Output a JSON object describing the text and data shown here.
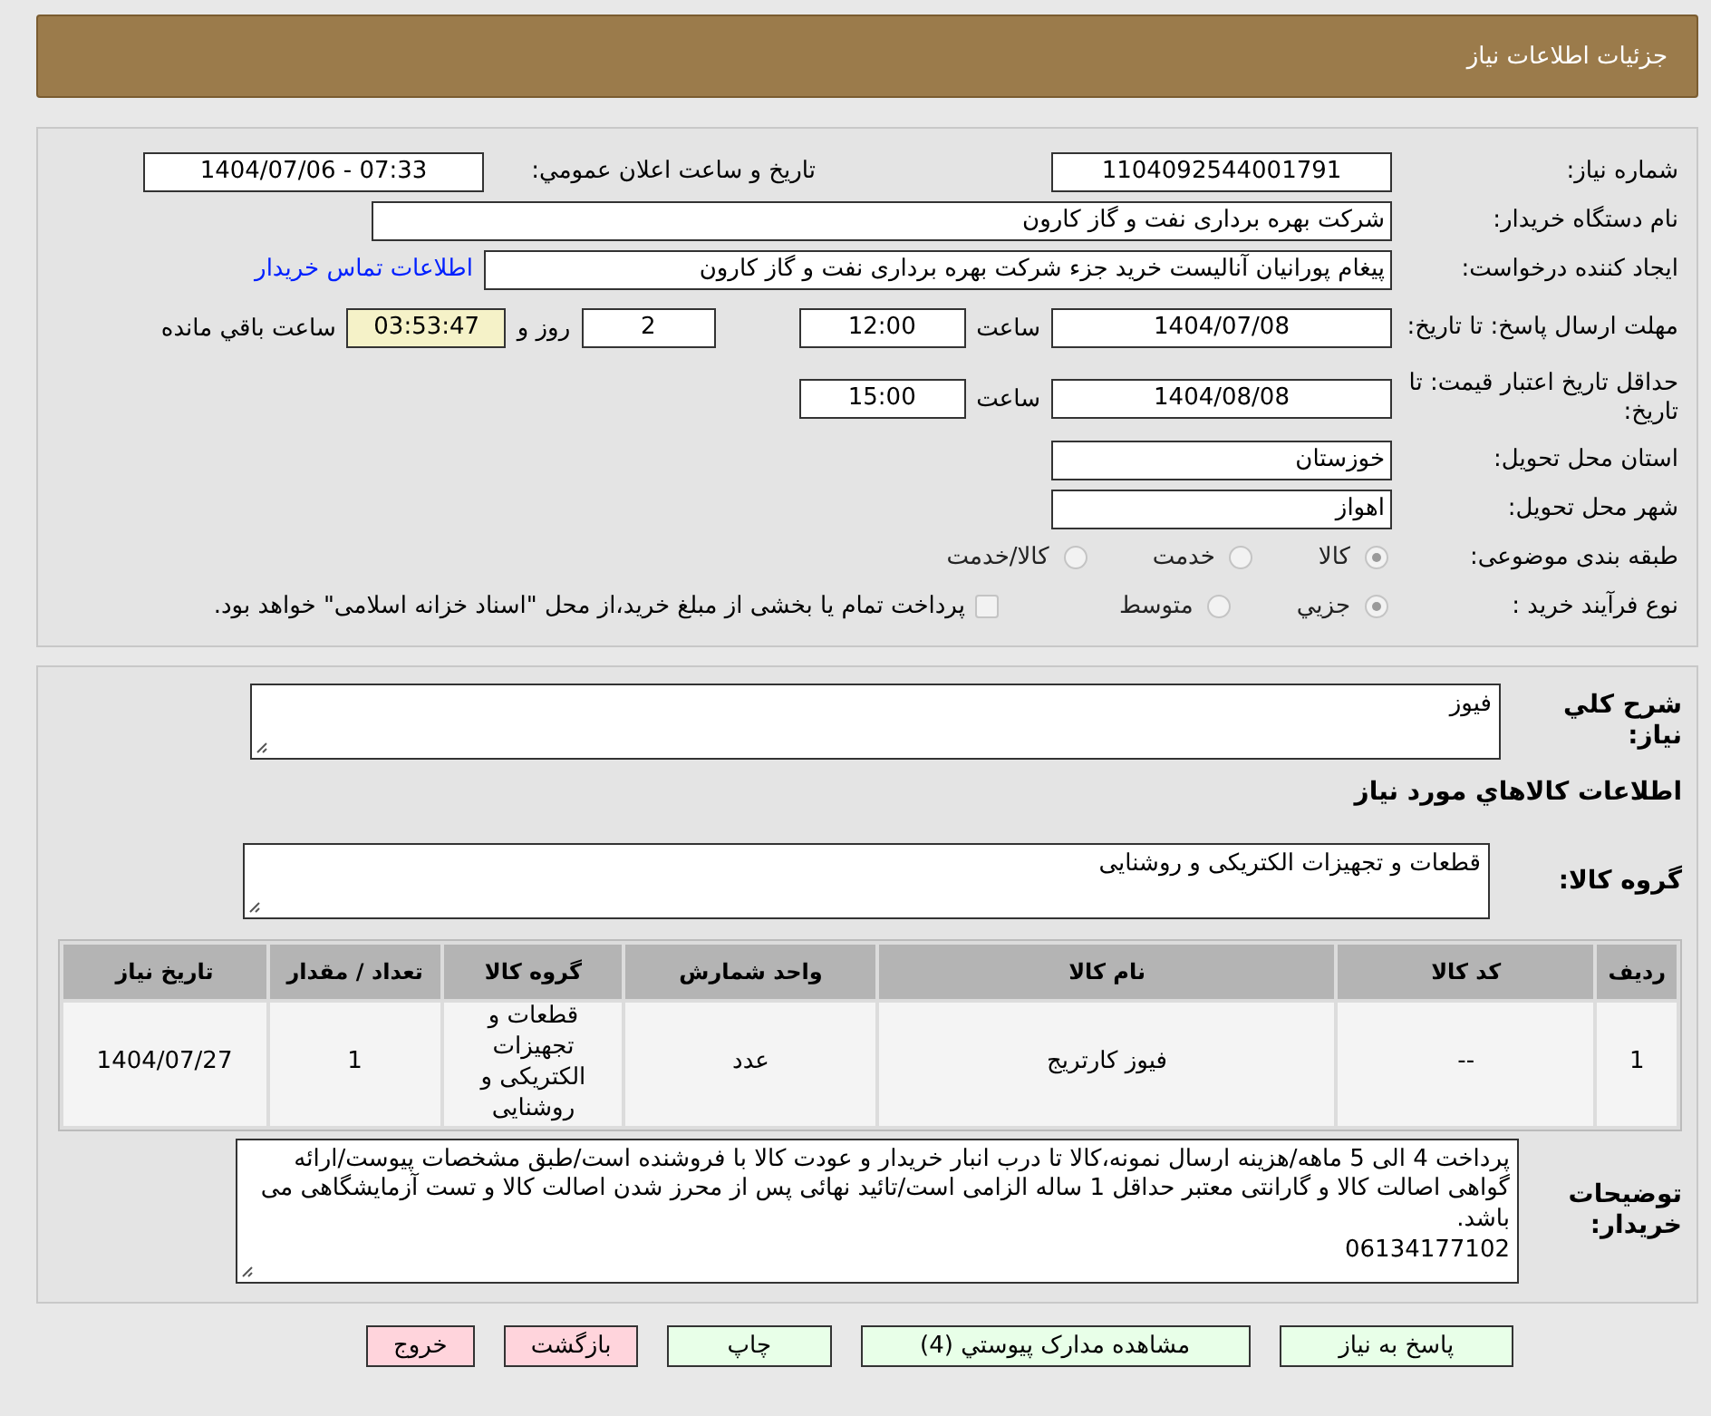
{
  "header": {
    "title": "جزئیات اطلاعات نیاز"
  },
  "details": {
    "need_number": {
      "label": "شماره نیاز:",
      "value": "1104092544001791"
    },
    "announce": {
      "label": "تاریخ و ساعت اعلان عمومي:",
      "value": "1404/07/06 - 07:33"
    },
    "buyer": {
      "label": "نام دستگاه خریدار:",
      "value": "شرکت بهره برداری نفت و گاز کارون"
    },
    "creator": {
      "label": "ایجاد کننده درخواست:",
      "value": "پیغام پورانیان آنالیست خرید جزء شرکت بهره برداری نفت و گاز کارون",
      "link": "اطلاعات تماس خریدار"
    },
    "deadline": {
      "label": "مهلت ارسال پاسخ: تا تاریخ:",
      "date": "1404/07/08",
      "time_label": "ساعت",
      "time": "12:00",
      "days": "2",
      "days_label": "روز و",
      "remaining": "03:53:47",
      "remaining_label": "ساعت باقي مانده"
    },
    "validity": {
      "label": "حداقل تاریخ اعتبار قیمت: تا تاریخ:",
      "date": "1404/08/08",
      "time_label": "ساعت",
      "time": "15:00"
    },
    "province": {
      "label": "استان محل تحویل:",
      "value": "خوزستان"
    },
    "city": {
      "label": "شهر محل تحویل:",
      "value": "اهواز"
    },
    "category": {
      "label": "طبقه بندی موضوعی:",
      "options": [
        {
          "label": "کالا",
          "selected": true
        },
        {
          "label": "خدمت",
          "selected": false
        },
        {
          "label": "کالا/خدمت",
          "selected": false
        }
      ]
    },
    "process": {
      "label": "نوع فرآیند خرید :",
      "options": [
        {
          "label": "جزيي",
          "selected": true
        },
        {
          "label": "متوسط",
          "selected": false
        }
      ],
      "treasury": {
        "label": "پرداخت تمام یا بخشی از مبلغ خرید،از محل \"اسناد خزانه اسلامی\" خواهد بود.",
        "checked": false
      }
    }
  },
  "summary": {
    "label": "شرح کلي نیاز:",
    "value": "فیوز"
  },
  "goods_heading": "اطلاعات کالاهاي مورد نیاز",
  "goods_group": {
    "label": "گروه کالا:",
    "value": "قطعات و تجهیزات الکتریکی و روشنایی"
  },
  "table": {
    "columns": [
      "ردیف",
      "کد کالا",
      "نام کالا",
      "واحد شمارش",
      "گروه کالا",
      "تعداد / مقدار",
      "تاریخ نیاز"
    ],
    "rows": [
      [
        "1",
        "--",
        "فیوز کارتریج",
        "عدد",
        "قطعات و تجهیزات الکتریکی و روشنایی",
        "1",
        "1404/07/27"
      ]
    ]
  },
  "notes": {
    "label": "توضیحات خریدار:",
    "value": "پرداخت 4 الی 5 ماهه/هزینه ارسال نمونه،کالا تا درب انبار خریدار و عودت کالا با فروشنده است/طبق مشخصات پیوست/ارائه گواهی اصالت کالا و گارانتی معتبر حداقل 1 ساله الزامی است/تائید نهائی پس از محرز شدن اصالت کالا و تست آزمایشگاهی می باشد.\n06134177102"
  },
  "buttons": [
    {
      "label": "پاسخ به نیاز",
      "kind": "normal"
    },
    {
      "label": "مشاهده مدارک پیوستي (4)",
      "kind": "normal"
    },
    {
      "label": "چاپ",
      "kind": "normal"
    },
    {
      "label": "بازگشت",
      "kind": "exit"
    },
    {
      "label": "خروج",
      "kind": "exit"
    }
  ]
}
